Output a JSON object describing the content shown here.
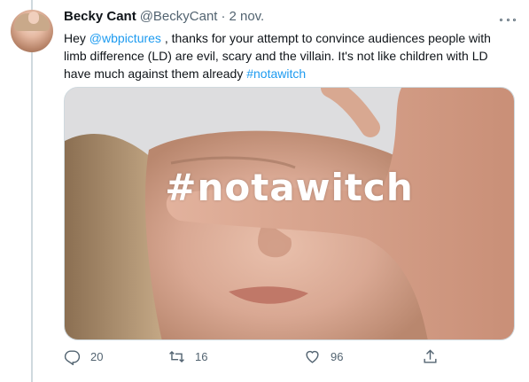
{
  "tweet": {
    "author_name": "Becky Cant",
    "author_handle": "@BeckyCant",
    "separator": "·",
    "time": "2 nov.",
    "text_segments": {
      "t1": "Hey ",
      "mention": "@wbpictures",
      "t2": " , thanks for your attempt to convince audiences people with limb difference (LD) are evil, scary and the villain. It's not like children with LD have much against them already ",
      "hashtag": "#notawitch"
    },
    "image_overlay_text": "#notawitch",
    "metrics": {
      "replies": "20",
      "retweets": "16",
      "likes": "96"
    }
  },
  "icons": {
    "more": "more-horizontal-icon",
    "reply": "reply-icon",
    "retweet": "retweet-icon",
    "like": "heart-icon",
    "share": "share-icon"
  },
  "colors": {
    "link": "#1d9bf0",
    "secondary_text": "#536471",
    "primary_text": "#0f1419",
    "thread_line": "#cfd9de"
  }
}
